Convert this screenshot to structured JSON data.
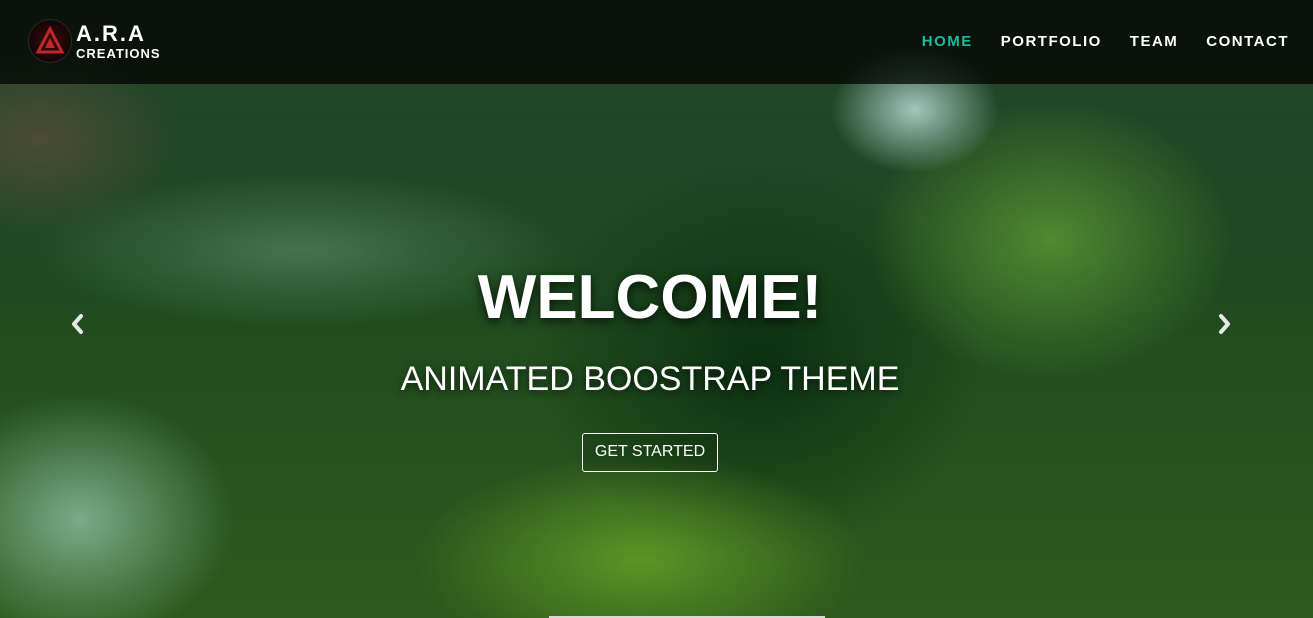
{
  "brand": {
    "title": "A.R.A",
    "subtitle": "CREATIONS"
  },
  "nav": {
    "items": [
      {
        "label": "HOME",
        "active": true
      },
      {
        "label": "PORTFOLIO",
        "active": false
      },
      {
        "label": "TEAM",
        "active": false
      },
      {
        "label": "CONTACT",
        "active": false
      }
    ]
  },
  "hero": {
    "title": "WELCOME!",
    "subtitle": "ANIMATED BOOSTRAP THEME",
    "button_label": "GET STARTED"
  },
  "icons": {
    "prev": "chevron-left-icon",
    "next": "chevron-right-icon"
  },
  "colors": {
    "accent": "#1abc9c",
    "navbar_bg": "#000000",
    "text": "#ffffff"
  }
}
